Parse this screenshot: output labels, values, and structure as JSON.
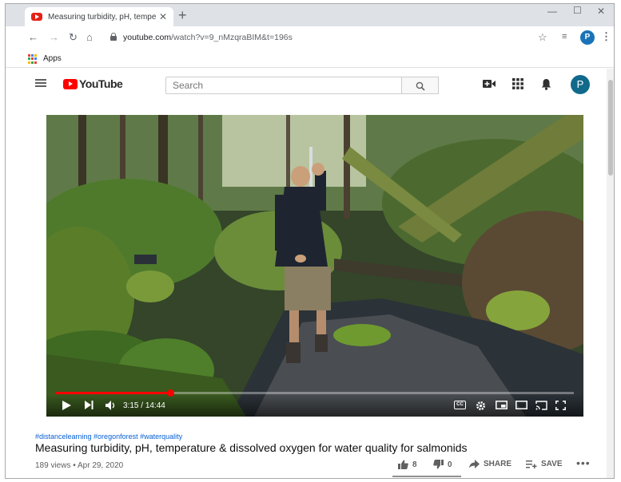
{
  "browser": {
    "tab_title": "Measuring turbidity, pH, tempe",
    "tab_close": "✕",
    "new_tab": "+",
    "url_host": "youtube.com",
    "url_path": "/watch?v=9_nMzqraBIM&t=196s",
    "profile_initial": "P",
    "bookmarks": {
      "apps_label": "Apps"
    },
    "icons": [
      "back-icon",
      "forward-icon",
      "reload-icon",
      "home-icon",
      "lock-icon",
      "star-icon",
      "queue-icon",
      "menu-icon"
    ]
  },
  "youtube": {
    "logo_text": "YouTube",
    "search_placeholder": "Search",
    "avatar_initial": "P",
    "brand_color": "#ff0000"
  },
  "player": {
    "time_current": "3:15",
    "time_sep": " / ",
    "time_total": "14:44",
    "progress_fraction": 0.22,
    "cc_label": "CC"
  },
  "video": {
    "hashtags": "#distancelearning #oregonforest #waterquality",
    "title": "Measuring turbidity, pH, temperature & dissolved oxygen for water quality for salmonids",
    "views": "189 views • Apr 29, 2020",
    "likes": "8",
    "dislikes": "0",
    "share_label": "SHARE",
    "save_label": "SAVE",
    "more_label": "•••"
  }
}
